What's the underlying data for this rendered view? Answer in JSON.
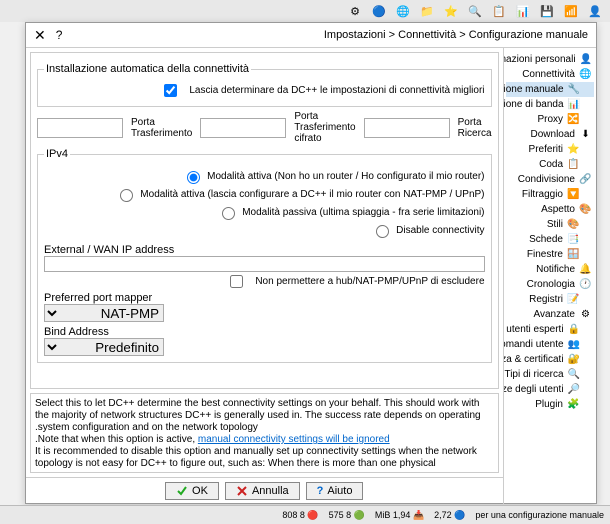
{
  "toolbar_icons": [
    "⚙",
    "🔵",
    "🌐",
    "📁",
    "⭐",
    "🔍",
    "📋",
    "📊",
    "🔔",
    "❓",
    "💾",
    "📶",
    "🐛",
    "👤",
    "📂"
  ],
  "breadcrumb": "Impostazioni > Connettività > Configurazione manuale",
  "sidebar": [
    {
      "icon": "👤",
      "label": "Informazioni personali",
      "child": false
    },
    {
      "icon": "🌐",
      "label": "Connettività",
      "child": false
    },
    {
      "icon": "🔧",
      "label": "Configurazione manuale",
      "child": true,
      "sel": true
    },
    {
      "icon": "📊",
      "label": "Limitazione di banda",
      "child": true
    },
    {
      "icon": "🔀",
      "label": "Proxy",
      "child": true
    },
    {
      "icon": "⬇",
      "label": "Download",
      "child": false
    },
    {
      "icon": "⭐",
      "label": "Preferiti",
      "child": true
    },
    {
      "icon": "📋",
      "label": "Coda",
      "child": true
    },
    {
      "icon": "🔗",
      "label": "Condivisione",
      "child": false
    },
    {
      "icon": "🔽",
      "label": "Filtraggio",
      "child": true
    },
    {
      "icon": "🎨",
      "label": "Aspetto",
      "child": false
    },
    {
      "icon": "🎨",
      "label": "Stili",
      "child": true
    },
    {
      "icon": "📑",
      "label": "Schede",
      "child": true
    },
    {
      "icon": "🪟",
      "label": "Finestre",
      "child": true
    },
    {
      "icon": "🔔",
      "label": "Notifiche",
      "child": false
    },
    {
      "icon": "🕐",
      "label": "Cronologia",
      "child": false
    },
    {
      "icon": "📝",
      "label": "Registri",
      "child": true
    },
    {
      "icon": "⚙",
      "label": "Avanzate",
      "child": false
    },
    {
      "icon": "🔒",
      "label": "Solo per utenti esperti",
      "child": true
    },
    {
      "icon": "👥",
      "label": "Comandi utente",
      "child": true
    },
    {
      "icon": "🔐",
      "label": "Sicurezza & certificati",
      "child": true
    },
    {
      "icon": "🔍",
      "label": "Tipi di ricerca",
      "child": true
    },
    {
      "icon": "🔎",
      "label": "Corrispondenze degli utenti",
      "child": true
    },
    {
      "icon": "🧩",
      "label": "Plugin",
      "child": true
    }
  ],
  "autodetect": {
    "legend": "Installazione automatica della connettività",
    "checkbox": "Lascia determinare da DC++ le impostazioni di connettività migliori"
  },
  "ports": {
    "transfer": "Porta Trasferimento",
    "encrypted": "Porta Trasferimento cifrato",
    "search": "Porta Ricerca"
  },
  "ipv4": {
    "legend": "IPv4",
    "radio1": "Modalità attiva (Non ho un router / Ho configurato il mio router)",
    "radio2": "Modalità attiva (lascia configurare a DC++ il mio router con NAT-PMP / UPnP)",
    "radio3": "Modalità passiva (ultima spiaggia - fra serie limitazioni)",
    "radio4": "Disable connectivity",
    "ext_ip_label": "External / WAN IP address",
    "no_override": "Non permettere a hub/NAT-PMP/UPnP di escludere",
    "mapper_label": "Preferred port mapper",
    "mapper_value": "NAT-PMP",
    "bind_label": "Bind Address",
    "bind_value": "Predefinito"
  },
  "help": {
    "line1": "Select this to let DC++ determine the best connectivity settings on your behalf. This should work with the majority of network structures DC++ is generally used in. The success rate depends on operating system configuration and on the network topology.",
    "link": "manual connectivity settings will be ignored",
    "line2": "Note that when this option is active, ",
    "line3": "It is recommended to disable this option and manually set up connectivity settings when the network topology is not easy for DC++ to figure out, such as: When there is more than one physical"
  },
  "buttons": {
    "ok": "OK",
    "cancel": "Annulla",
    "help": "Aiuto"
  },
  "statusbar": [
    "per una configurazione manuale",
    "2,72",
    "MiB 1,94",
    "8 575",
    "8 808"
  ]
}
